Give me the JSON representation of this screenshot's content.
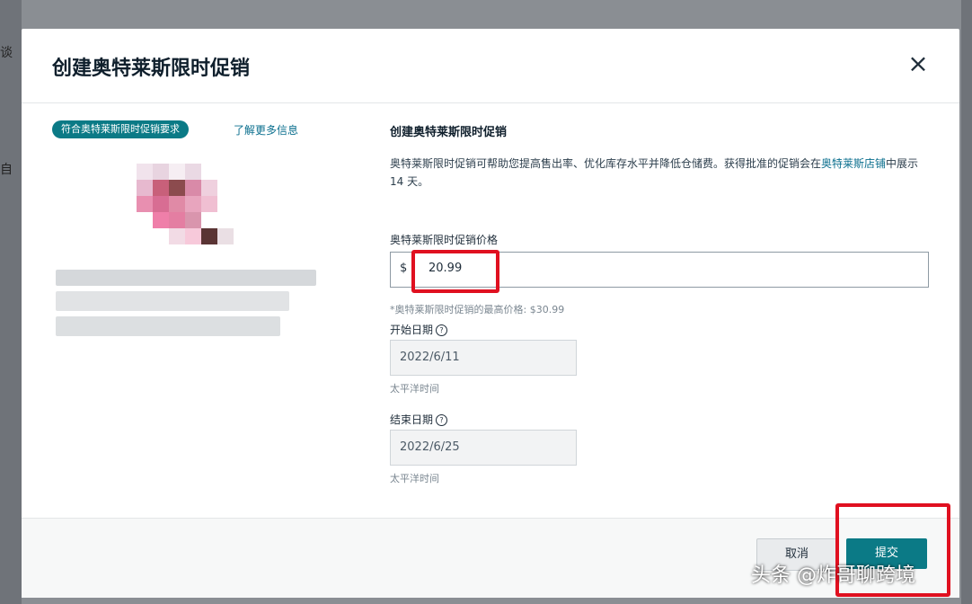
{
  "dialog": {
    "title": "创建奥特莱斯限时促销",
    "close_symbol": "×"
  },
  "left_panel": {
    "badge": "符合奥特莱斯限时促销要求",
    "learn_more": "了解更多信息"
  },
  "form": {
    "section_title": "创建奥特莱斯限时促销",
    "description_part1": "奥特莱斯限时促销可帮助您提高售出率、优化库存水平并降低仓储费。获得批准的促销会在",
    "description_link": "奥特莱斯店铺",
    "description_part2": "中展示 14 天。",
    "price_label": "奥特莱斯限时促销价格",
    "currency": "$",
    "price_value": "20.99",
    "price_hint": "*奥特莱斯限时促销的最高价格: $30.99",
    "start_label": "开始日期",
    "start_value": "2022/6/11",
    "start_hint": "太平洋时间",
    "end_label": "结束日期",
    "end_value": "2022/6/25",
    "end_hint": "太平洋时间",
    "info_symbol": "?"
  },
  "footer": {
    "cancel_label": "取消",
    "submit_label": "提交"
  },
  "watermark": "头条 @炸哥聊跨境",
  "colors": {
    "accent": "#0b7a86",
    "highlight": "#e01020",
    "link": "#0b6f8e"
  }
}
